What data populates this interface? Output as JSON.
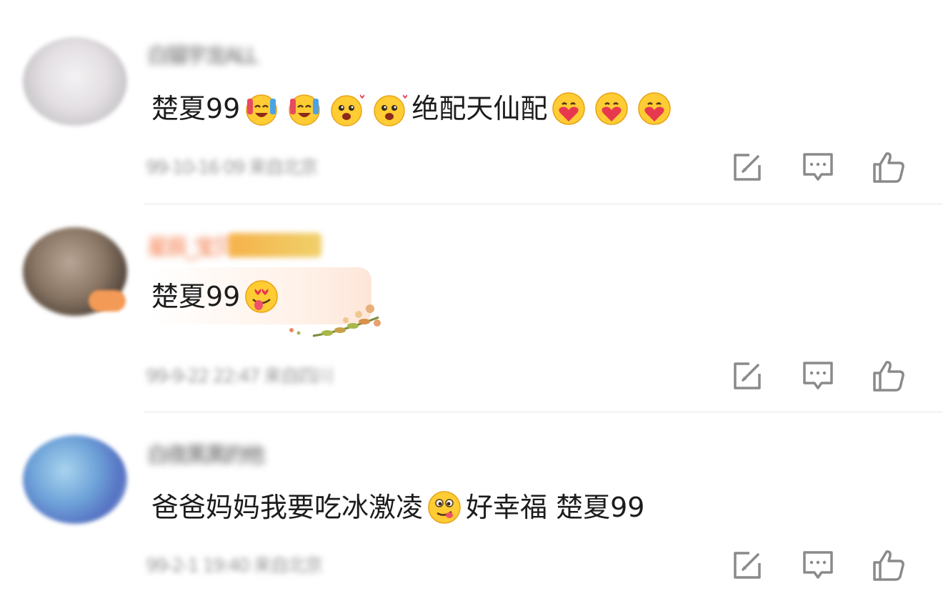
{
  "comments": [
    {
      "username": "白猫宇龙ALL",
      "text_parts": [
        "楚夏99",
        "绝配天仙配"
      ],
      "emojis": [
        "tears-of-joy-icon",
        "tears-of-joy-icon",
        "heart-eyes-blush-icon",
        "heart-eyes-blush-icon",
        "hugging-heart-icon",
        "hugging-heart-icon",
        "hugging-heart-icon"
      ],
      "meta": "99-10-16 09 来自北京"
    },
    {
      "username": "星辰_宝贝",
      "text_parts": [
        "楚夏99"
      ],
      "emojis": [
        "heart-eyes-tongue-icon"
      ],
      "meta": "99-9-22 22:47 来自四川"
    },
    {
      "username": "白夜黑黑的他",
      "text_parts": [
        "爸爸妈妈我要吃冰激凌",
        "好幸福 楚夏99"
      ],
      "emojis": [
        "yummy-face-icon"
      ],
      "meta": "99-2-1 19:40 来自北京"
    }
  ],
  "actions": {
    "share": "share-icon",
    "reply": "comment-icon",
    "like": "thumbs-up-icon"
  },
  "colors": {
    "text": "#1c1c1c",
    "meta": "#9a9a9a",
    "icon": "#8a8a8a",
    "divider": "#e6e6e6",
    "username_vip": "#f2703a"
  }
}
